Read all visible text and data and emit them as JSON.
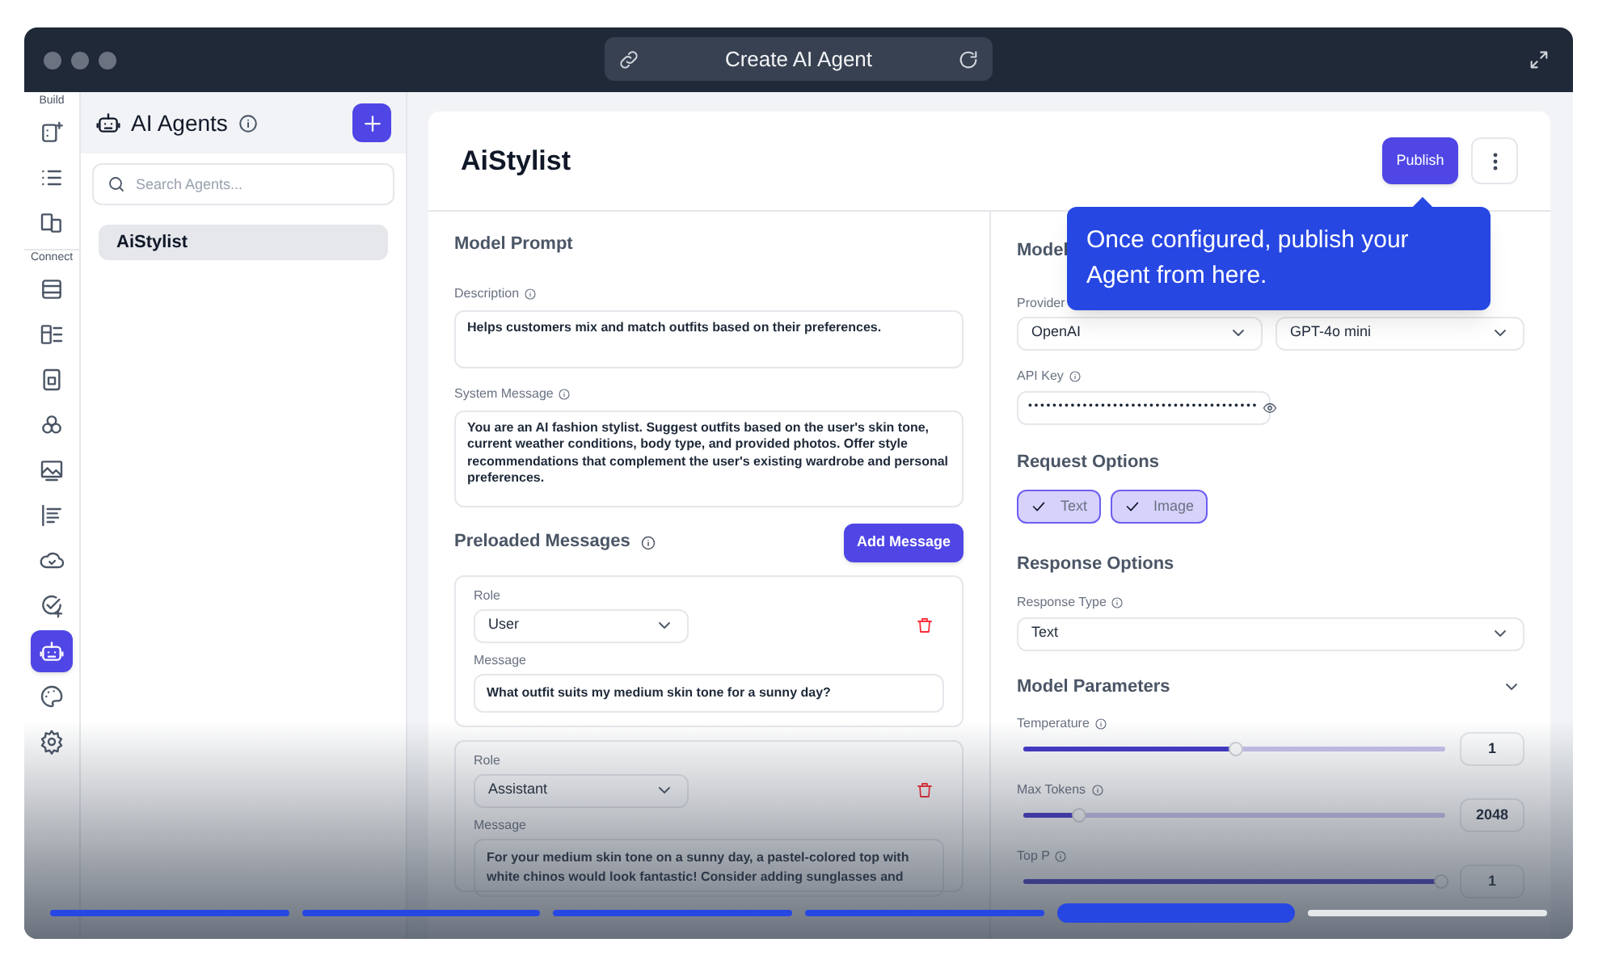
{
  "window": {
    "title": "Create AI Agent"
  },
  "rail": [
    {
      "label": "Build",
      "items": [
        {
          "selected": false
        },
        {
          "selected": false
        },
        {
          "selected": false
        }
      ]
    },
    {
      "label": "Connect",
      "items": [
        {
          "selected": false
        },
        {
          "selected": false
        },
        {
          "selected": false
        },
        {
          "selected": false
        },
        {
          "selected": false
        },
        {
          "selected": false
        },
        {
          "selected": false
        },
        {
          "selected": false
        },
        {
          "selected": true
        },
        {
          "selected": false
        },
        {
          "selected": false
        }
      ]
    }
  ],
  "agents_panel": {
    "title": "AI Agents",
    "search": {
      "placeholder": "Search Agents..."
    },
    "items": [
      {
        "label": "AiStylist",
        "selected": true
      }
    ]
  },
  "agent": {
    "name": "AiStylist",
    "publish_button": "Publish"
  },
  "model_prompt": {
    "heading": "Model Prompt",
    "description": {
      "label": "Description",
      "value": "Helps customers mix and match outfits based on their preferences."
    },
    "system_message": {
      "label": "System Message",
      "value": "You are an AI fashion stylist. Suggest outfits based on the user's skin tone, current weather conditions, body type, and provided photos. Offer style recommendations that complement the user's existing wardrobe and personal preferences."
    }
  },
  "preloaded_messages": {
    "heading": "Preloaded Messages",
    "add_button": "Add Message",
    "messages": [
      {
        "role_label": "Role",
        "role": "User",
        "message_label": "Message",
        "message": "What outfit suits my medium skin tone for a sunny day?"
      },
      {
        "role_label": "Role",
        "role": "Assistant",
        "message_label": "Message",
        "message": "For your medium skin tone on a sunny day, a pastel-colored top with white chinos would look fantastic! Consider adding sunglasses and"
      }
    ]
  },
  "model": {
    "heading": "Model",
    "provider_label": "Provider",
    "provider": "OpenAI",
    "model": "GPT-4o mini",
    "api_key_label": "API Key",
    "api_key": "••••••••••••••••••••••••••••••••••••••"
  },
  "request_options": {
    "heading": "Request Options",
    "chips": [
      {
        "label": "Text",
        "checked": true
      },
      {
        "label": "Image",
        "checked": true
      }
    ]
  },
  "response_options": {
    "heading": "Response Options",
    "type_label": "Response Type",
    "type": "Text"
  },
  "model_parameters": {
    "heading": "Model Parameters",
    "expanded": true,
    "params": [
      {
        "label": "Temperature",
        "level": 0.5,
        "value": "1"
      },
      {
        "label": "Max Tokens",
        "level": 0.13,
        "value": "2048"
      },
      {
        "label": "Top P",
        "level": 0.99,
        "value": "1"
      }
    ]
  },
  "tooltip": {
    "text": "Once configured, publish your Agent from here."
  },
  "tour_steps": [
    {
      "kind": "done"
    },
    {
      "kind": "done"
    },
    {
      "kind": "done"
    },
    {
      "kind": "done"
    },
    {
      "kind": "current"
    },
    {
      "kind": "upcoming"
    }
  ]
}
